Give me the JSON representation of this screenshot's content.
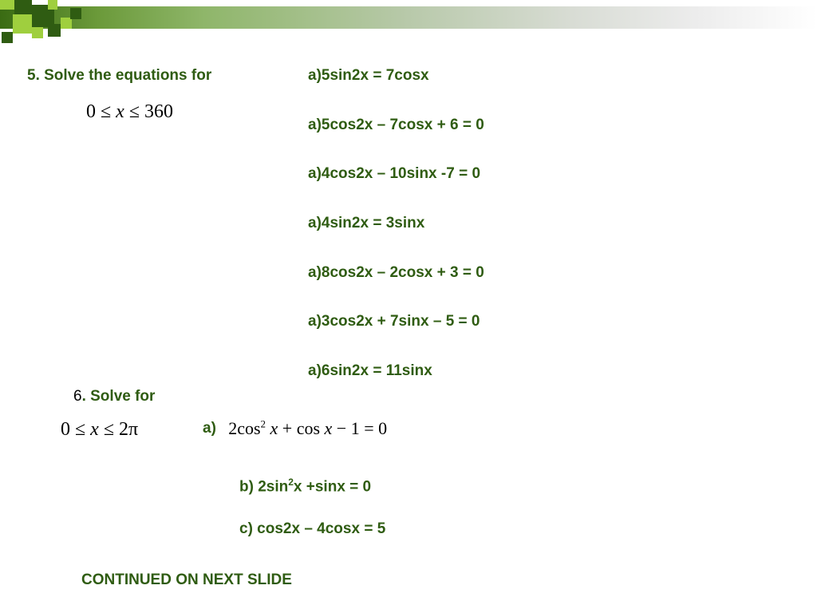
{
  "q5": {
    "title": "5.  Solve the equations for",
    "range": {
      "lhs": "0",
      "rel1": "≤",
      "var": "x",
      "rel2": "≤",
      "rhs": "360"
    },
    "items": [
      "a)5sin2x = 7cosx",
      "a)5cos2x – 7cosx + 6 = 0",
      "a)4cos2x – 10sinx -7 = 0",
      "a)4sin2x = 3sinx",
      "a)8cos2x – 2cosx + 3 = 0",
      "a)3cos2x + 7sinx – 5 = 0",
      "a)6sin2x = 11sinx"
    ]
  },
  "q6": {
    "num": "6",
    "title": ".  Solve for",
    "range": {
      "lhs": "0",
      "rel1": "≤",
      "var": "x",
      "rel2": "≤",
      "rhs": "2π"
    },
    "a_label": "a)",
    "a_eq": {
      "coef1": "2",
      "fn1": "cos",
      "exp": "2",
      "arg1": "x",
      "plus": "+",
      "fn2": "cos",
      "arg2": "x",
      "tail": "− 1 = 0"
    },
    "b": "b)  2sin",
    "b_exp": "2",
    "b_tail": "x +sinx = 0",
    "c": "c)  cos2x – 4cosx = 5"
  },
  "continued": "CONTINUED ON NEXT SLIDE"
}
